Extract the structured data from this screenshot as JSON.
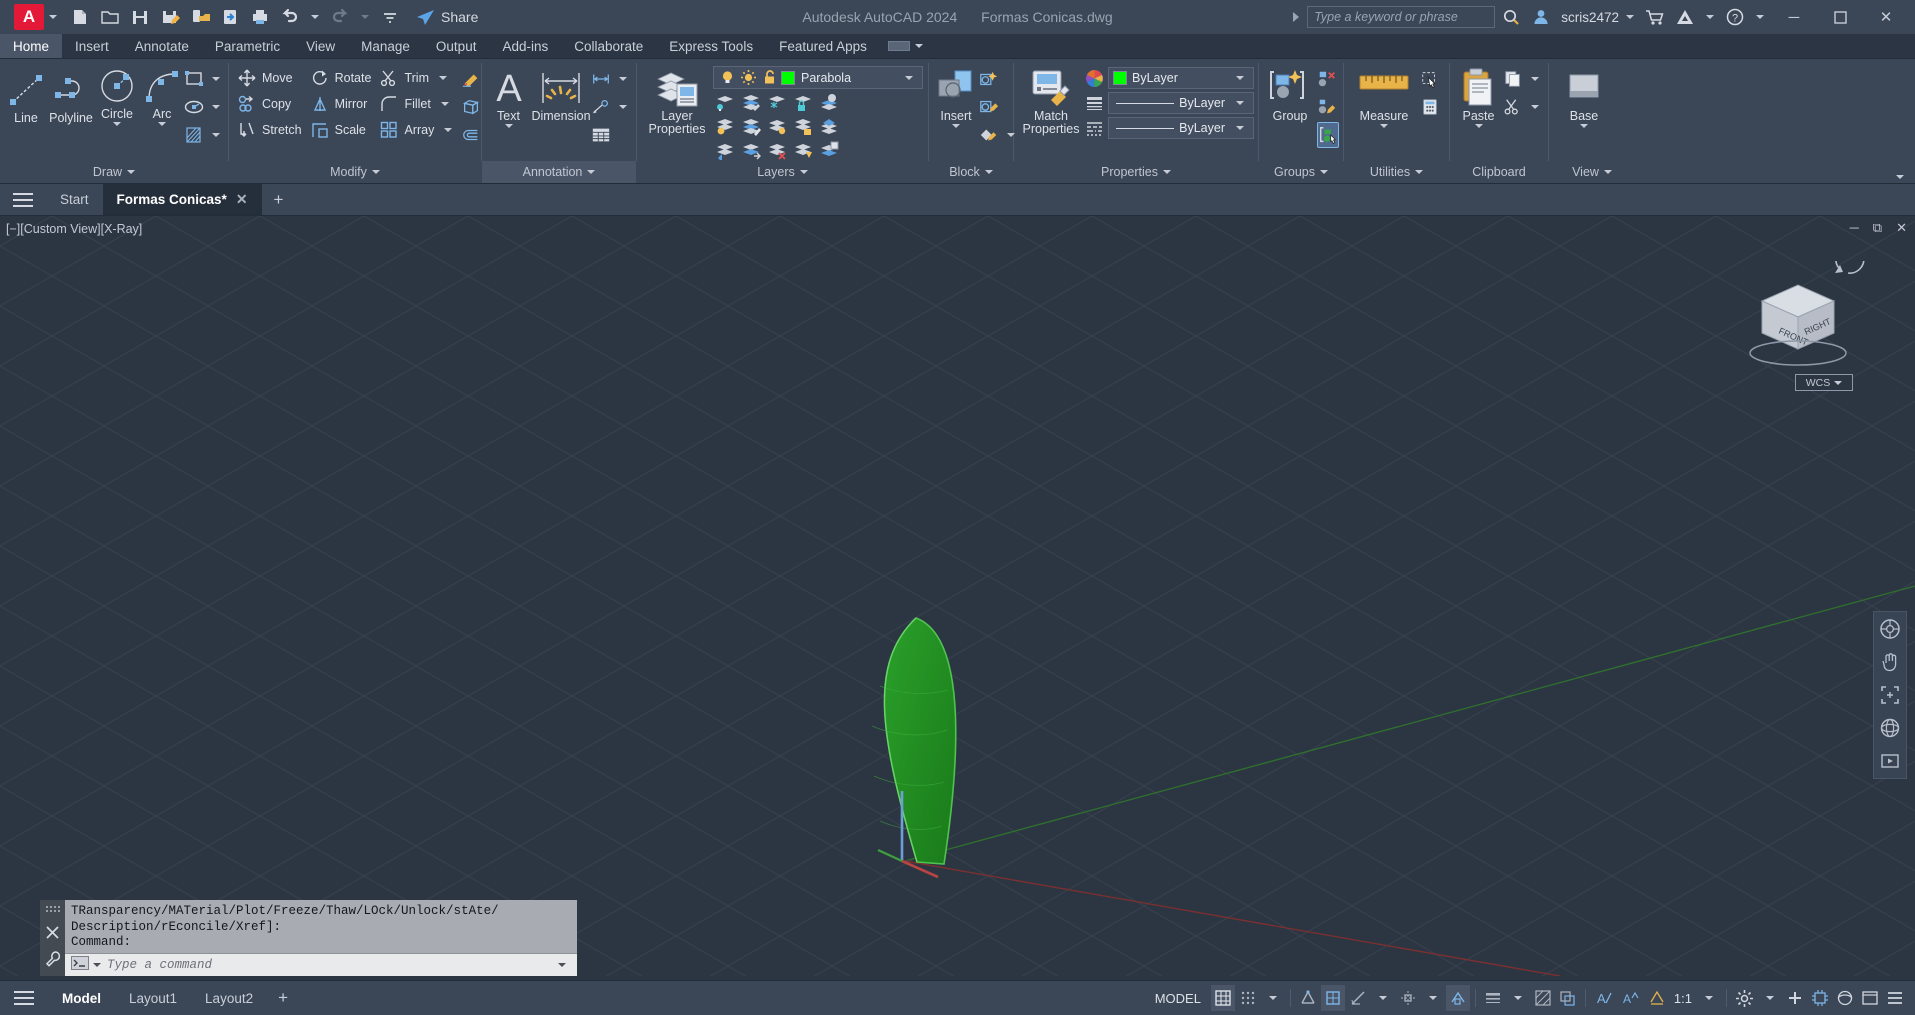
{
  "titlebar": {
    "logo": "A",
    "app_title": "Autodesk AutoCAD 2024",
    "file_name": "Formas Conicas.dwg",
    "share_label": "Share",
    "search_placeholder": "Type a keyword or phrase",
    "user_name": "scris2472",
    "qat": [
      {
        "name": "new-icon",
        "tip": "New"
      },
      {
        "name": "open-icon",
        "tip": "Open"
      },
      {
        "name": "save-icon",
        "tip": "Save"
      },
      {
        "name": "save-as-icon",
        "tip": "Save As"
      },
      {
        "name": "save-to-web-icon",
        "tip": "Save to Web & Mobile"
      },
      {
        "name": "open-from-web-icon",
        "tip": "Open from Web & Mobile"
      },
      {
        "name": "plot-icon",
        "tip": "Plot"
      },
      {
        "name": "undo-icon",
        "tip": "Undo"
      },
      {
        "name": "redo-icon",
        "tip": "Redo"
      }
    ],
    "window_buttons": {
      "minimize": "─",
      "maximize": "⬜",
      "close": "✕"
    }
  },
  "ribbon_tabs": [
    {
      "label": "Home",
      "active": true
    },
    {
      "label": "Insert",
      "active": false
    },
    {
      "label": "Annotate",
      "active": false
    },
    {
      "label": "Parametric",
      "active": false
    },
    {
      "label": "View",
      "active": false
    },
    {
      "label": "Manage",
      "active": false
    },
    {
      "label": "Output",
      "active": false
    },
    {
      "label": "Add-ins",
      "active": false
    },
    {
      "label": "Collaborate",
      "active": false
    },
    {
      "label": "Express Tools",
      "active": false
    },
    {
      "label": "Featured Apps",
      "active": false
    }
  ],
  "ribbon": {
    "draw": {
      "title": "Draw",
      "big": [
        {
          "label": "Line",
          "icon": "line-icon",
          "dropdown": false
        },
        {
          "label": "Polyline",
          "icon": "polyline-icon",
          "dropdown": false
        },
        {
          "label": "Circle",
          "icon": "circle-icon",
          "dropdown": true
        },
        {
          "label": "Arc",
          "icon": "arc-icon",
          "dropdown": true
        }
      ],
      "small": [
        {
          "name": "rectangle-icon",
          "dropdown": true
        },
        {
          "name": "ellipse-icon",
          "dropdown": true
        },
        {
          "name": "hatch-icon",
          "dropdown": true
        }
      ]
    },
    "modify": {
      "title": "Modify",
      "items": [
        {
          "label": "Move",
          "icon": "move-icon",
          "dropdown": false
        },
        {
          "label": "Rotate",
          "icon": "rotate-icon",
          "dropdown": false
        },
        {
          "label": "Trim",
          "icon": "trim-icon",
          "dropdown": true
        },
        {
          "label": "Copy",
          "icon": "copy-icon",
          "dropdown": false
        },
        {
          "label": "Mirror",
          "icon": "mirror-icon",
          "dropdown": false
        },
        {
          "label": "Fillet",
          "icon": "fillet-icon",
          "dropdown": true
        },
        {
          "label": "Stretch",
          "icon": "stretch-icon",
          "dropdown": false
        },
        {
          "label": "Scale",
          "icon": "scale-icon",
          "dropdown": false
        },
        {
          "label": "Array",
          "icon": "array-icon",
          "dropdown": true
        }
      ],
      "extras": [
        {
          "name": "erase-icon"
        },
        {
          "name": "explode-icon"
        },
        {
          "name": "offset-icon"
        }
      ]
    },
    "annotation": {
      "title": "Annotation",
      "big": [
        {
          "label": "Text",
          "icon": "text-icon",
          "dropdown": true
        },
        {
          "label": "Dimension",
          "icon": "dimension-icon",
          "dropdown": false
        }
      ],
      "small": [
        {
          "name": "dimension-style-icon",
          "dropdown": true
        },
        {
          "name": "leader-icon",
          "dropdown": true
        },
        {
          "name": "table-icon",
          "dropdown": false
        }
      ]
    },
    "layers": {
      "title": "Layers",
      "big": [
        {
          "label": "Layer\nProperties",
          "icon": "layer-properties-icon"
        }
      ],
      "current_layer": {
        "name": "Parabola",
        "color": "#00ff00",
        "on_icon": "lightbulb-on-icon",
        "freeze_icon": "sun-icon",
        "lock_icon": "unlock-icon"
      },
      "tool_icons": [
        "layer-isolate-icon",
        "layer-unisolate-icon",
        "layer-freeze-icon",
        "layer-lock-icon",
        "layer-make-current-icon",
        "layer-off-icon",
        "layer-turn-all-on-icon",
        "layer-thaw-all-icon",
        "layer-unlock-icon",
        "layer-match-icon",
        "layer-previous-icon",
        "layer-merge-icon",
        "layer-delete-icon",
        "layer-walk-icon",
        "layer-state-icon"
      ]
    },
    "block": {
      "title": "Block",
      "big": [
        {
          "label": "Insert",
          "icon": "insert-block-icon",
          "dropdown": true
        }
      ],
      "small": [
        {
          "name": "create-block-icon"
        },
        {
          "name": "edit-block-icon"
        },
        {
          "name": "edit-attribute-icon",
          "dropdown": true
        }
      ]
    },
    "properties": {
      "title": "Properties",
      "big": [
        {
          "label": "Match\nProperties",
          "icon": "match-properties-icon"
        }
      ],
      "rows": [
        {
          "icon": "color-wheel-icon",
          "value": "ByLayer",
          "swatch": "#00ff00",
          "type": "color"
        },
        {
          "icon": "linewidth-icon",
          "value": "ByLayer",
          "type": "lineweight"
        },
        {
          "icon": "linetype-icon",
          "value": "ByLayer",
          "type": "linetype"
        }
      ]
    },
    "groups": {
      "title": "Groups",
      "big": [
        {
          "label": "Group",
          "icon": "group-icon"
        }
      ],
      "small": [
        {
          "name": "ungroup-icon"
        },
        {
          "name": "group-edit-icon"
        },
        {
          "name": "group-selection-on-off-icon",
          "selected": true
        }
      ]
    },
    "utilities": {
      "title": "Utilities",
      "big": [
        {
          "label": "Measure",
          "icon": "measure-icon",
          "dropdown": true
        }
      ],
      "small": [
        {
          "name": "quick-select-icon"
        },
        {
          "name": "quick-calculator-icon"
        }
      ]
    },
    "clipboard": {
      "title": "Clipboard",
      "big": [
        {
          "label": "Paste",
          "icon": "paste-icon",
          "dropdown": true
        }
      ],
      "small": [
        {
          "name": "copy-clip-icon",
          "dropdown": true
        },
        {
          "name": "cut-clip-icon",
          "dropdown": true
        }
      ]
    },
    "view": {
      "title": "View",
      "big": [
        {
          "label": "Base",
          "icon": "base-view-icon",
          "dropdown": true
        }
      ]
    }
  },
  "doctabs": {
    "menu_icon": "hamburger-menu-icon",
    "tabs": [
      {
        "label": "Start",
        "active": false,
        "closable": false
      },
      {
        "label": "Formas Conicas*",
        "active": true,
        "closable": true
      }
    ],
    "new_tab": "+"
  },
  "canvas": {
    "viewport_label": "[−][Custom View][X-Ray]",
    "window_controls": {
      "minimize": "─",
      "restore": "❐",
      "close": "✕"
    },
    "viewcube": {
      "front": "FRONT",
      "right": "RIGHT",
      "wcs_label": "WCS"
    },
    "model_shape": {
      "name": "parabola-solid",
      "fill": "#1f8a1f",
      "stroke": "#55d055"
    },
    "axes": {
      "x_color": "#b03a3a",
      "y_color": "#3c8f3c",
      "z_color": "#5a8ccc"
    },
    "navbar_icons": [
      "steering-wheel-icon",
      "pan-icon",
      "zoom-extents-icon",
      "orbit-icon",
      "showmotion-icon"
    ]
  },
  "command_line": {
    "history": "TRansparency/MATerial/Plot/Freeze/Thaw/LOck/Unlock/stAte/\nDescription/rEconcile/Xref]:\nCommand:",
    "placeholder": "Type a command",
    "close_icon": "close-icon",
    "settings_icon": "wrench-icon",
    "grip_icon": "grip-dots-icon",
    "prompt_icon": "command-prompt-icon"
  },
  "statusbar": {
    "menu_icon": "hamburger-menu-icon",
    "layout_tabs": [
      {
        "label": "Model",
        "active": true
      },
      {
        "label": "Layout1",
        "active": false
      },
      {
        "label": "Layout2",
        "active": false
      }
    ],
    "new_layout": "+",
    "model_label": "MODEL",
    "scale_label": "1:1",
    "right_icons": [
      {
        "name": "grid-display-icon",
        "on": true
      },
      {
        "name": "snap-mode-icon",
        "on": false
      },
      {
        "name": "snap-mode-dropdown-icon",
        "on": false
      },
      {
        "name": "infer-constraints-icon",
        "on": false
      },
      {
        "name": "ortho-mode-icon",
        "on": true
      },
      {
        "name": "polar-tracking-icon",
        "on": false
      },
      {
        "name": "polar-tracking-dropdown-icon",
        "on": false
      },
      {
        "name": "object-snap-tracking-icon",
        "on": false
      },
      {
        "name": "object-snap-dropdown-icon",
        "on": false
      },
      {
        "name": "object-snap-icon",
        "on": true
      },
      {
        "name": "lineweight-icon",
        "on": false
      },
      {
        "name": "lineweight-dropdown-icon",
        "on": false
      },
      {
        "name": "transparency-icon",
        "on": false
      },
      {
        "name": "selection-cycling-icon",
        "on": false
      },
      {
        "name": "annotation-scale-icon",
        "on": false
      },
      {
        "name": "scale-dropdown-icon",
        "on": false
      },
      {
        "name": "workspace-settings-icon",
        "on": false
      },
      {
        "name": "workspace-dropdown-icon",
        "on": false
      },
      {
        "name": "customization-add-icon",
        "on": false
      },
      {
        "name": "hardware-acceleration-icon",
        "on": false
      },
      {
        "name": "isolate-objects-icon",
        "on": false
      },
      {
        "name": "clean-screen-icon",
        "on": false
      },
      {
        "name": "customization-menu-icon",
        "on": false
      }
    ]
  }
}
